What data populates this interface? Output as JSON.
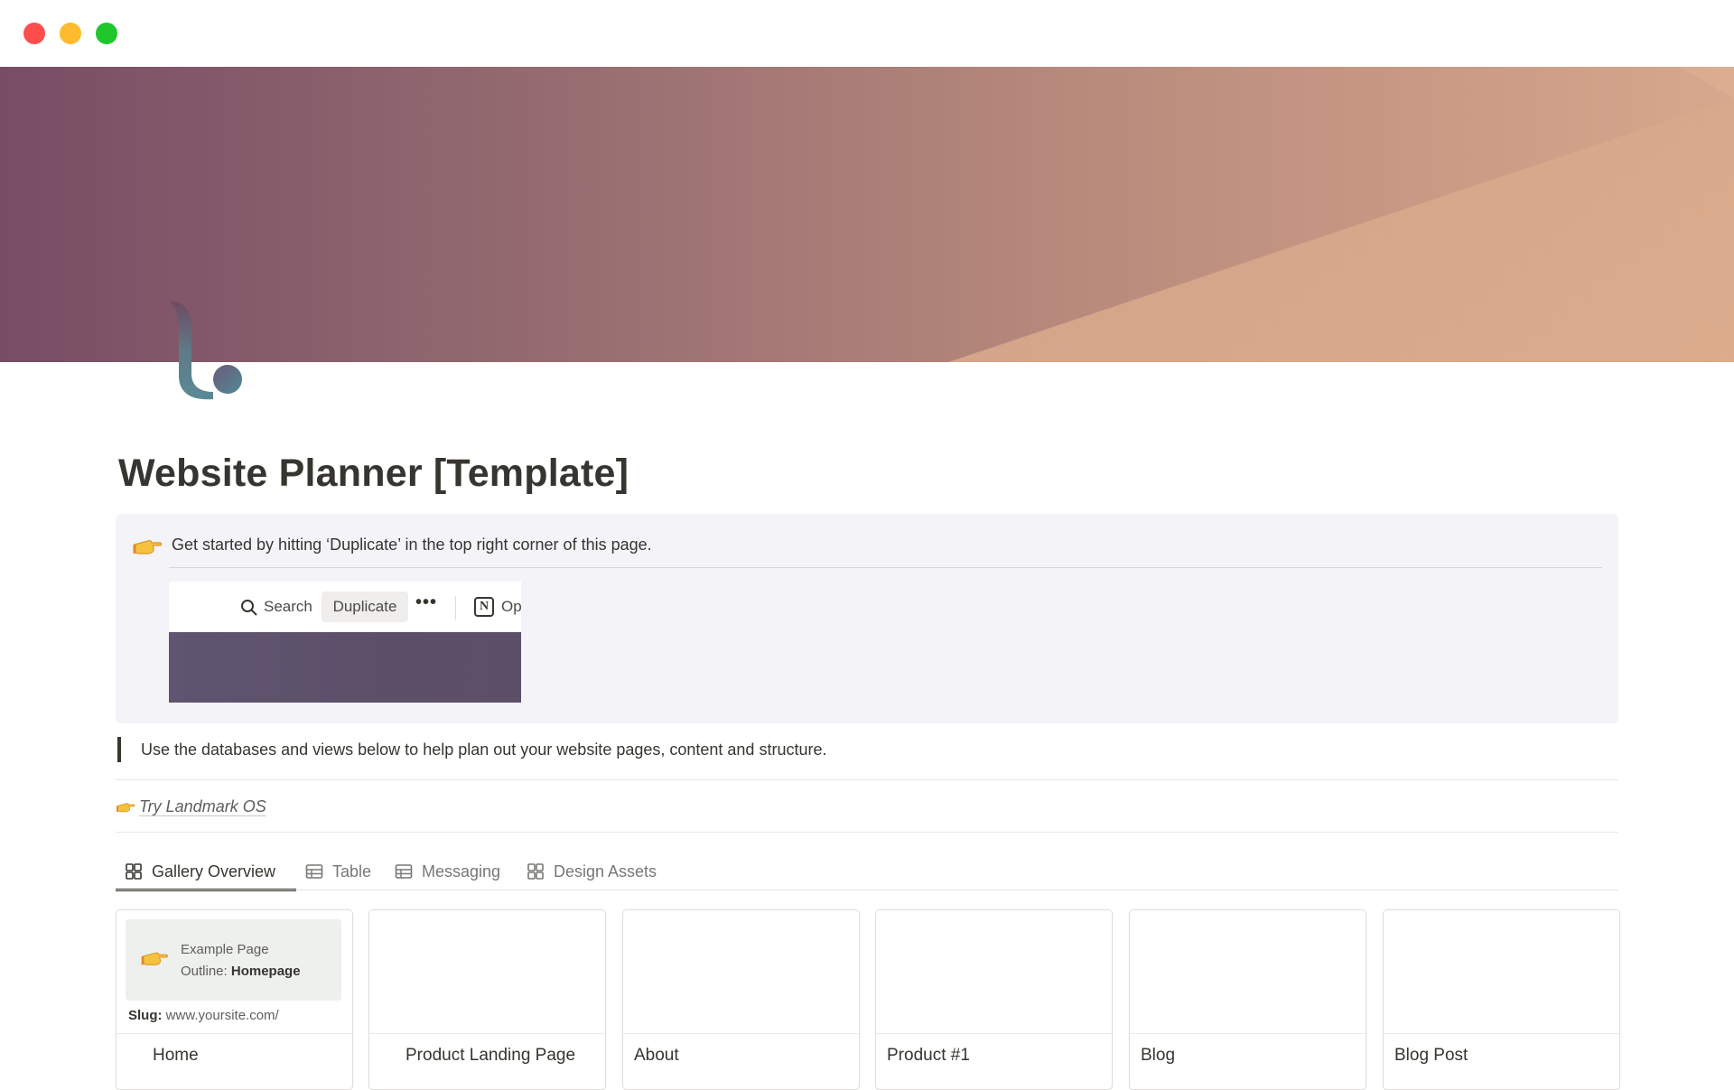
{
  "window": {
    "controls": [
      "close",
      "minimize",
      "maximize"
    ],
    "colors": {
      "close": "#fe4d4d",
      "minimize": "#febb2d",
      "maximize": "#1fc72a"
    }
  },
  "cover": {
    "colors": [
      "#774d65",
      "#946a70",
      "#b88a7c",
      "#d7a88c"
    ]
  },
  "page": {
    "icon": "landmark-logo-icon",
    "title": "Website Planner [Template]"
  },
  "callout": {
    "icon": "pointing-hand-icon",
    "text": "Get started by  hitting ‘Duplicate’ in the top right corner of this page.",
    "screenshot": {
      "search_label": "Search",
      "duplicate_label": "Duplicate",
      "more_label": "•••",
      "notion_glyph": "N",
      "open_label": "Op"
    }
  },
  "quote": {
    "text": "Use the databases and views below to help plan out your website pages, content and structure."
  },
  "link": {
    "icon": "pointing-hand-icon",
    "text": "Try Landmark OS"
  },
  "tabs": [
    {
      "label": "Gallery Overview",
      "icon": "gallery-icon",
      "active": true
    },
    {
      "label": "Table",
      "icon": "table-icon",
      "active": false
    },
    {
      "label": "Messaging",
      "icon": "table-icon",
      "active": false
    },
    {
      "label": "Design Assets",
      "icon": "gallery-icon",
      "active": false
    }
  ],
  "cards": [
    {
      "name": "Home",
      "preview": {
        "line1": "Example Page",
        "line2_prefix": "Outline:",
        "line2_bold": "Homepage"
      },
      "slug_label": "Slug:",
      "slug_value": "www.yoursite.com/"
    },
    {
      "name": "Product Landing Page"
    },
    {
      "name": "About"
    },
    {
      "name": "Product #1"
    },
    {
      "name": "Blog"
    },
    {
      "name": "Blog Post"
    }
  ]
}
